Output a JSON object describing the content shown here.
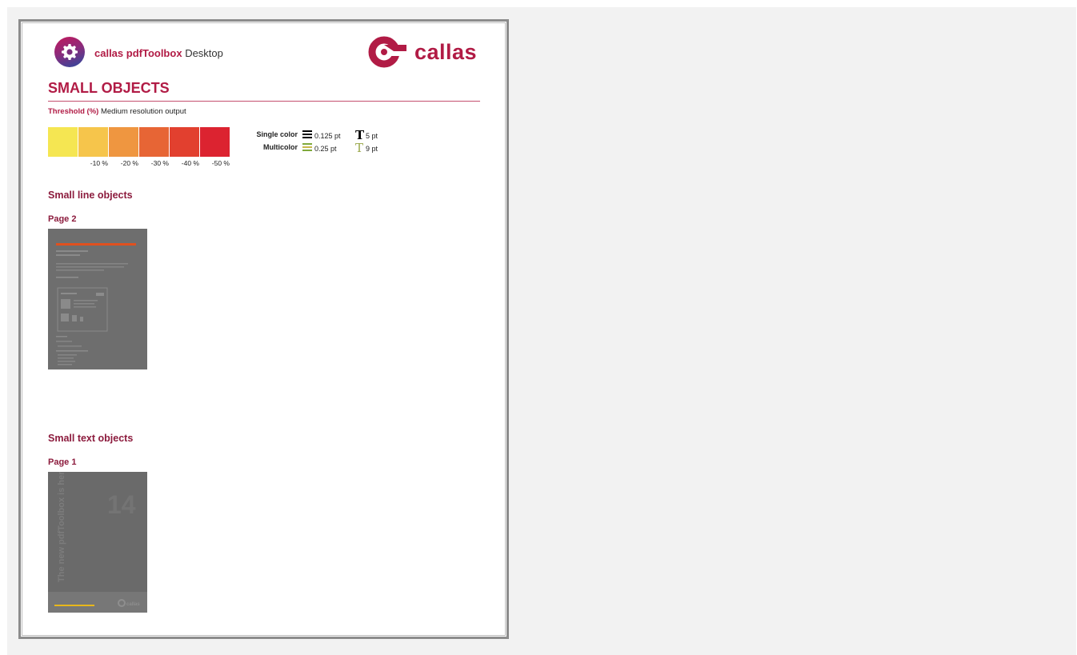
{
  "header": {
    "product_brand": "callas pdfToolbox",
    "product_edition": "Desktop",
    "company_logo_text": "callas"
  },
  "report": {
    "title": "SMALL OBJECTS",
    "threshold_label": "Threshold (%)",
    "threshold_value": "Medium resolution output"
  },
  "severity_scale": {
    "swatches": [
      {
        "color": "#f5e652",
        "label": ""
      },
      {
        "color": "#f6c54b",
        "label": "-10 %"
      },
      {
        "color": "#ef9640",
        "label": "-20 %"
      },
      {
        "color": "#e76535",
        "label": "-30 %"
      },
      {
        "color": "#e2402f",
        "label": "-40 %"
      },
      {
        "color": "#dc2330",
        "label": "-50 %"
      }
    ]
  },
  "legend": {
    "single_label": "Single color",
    "single_line": "0.125 pt",
    "single_text": "5 pt",
    "multi_label": "Multicolor",
    "multi_line": "0.25 pt",
    "multi_text": "9 pt",
    "text_icon": "T"
  },
  "sections": [
    {
      "title": "Small line objects",
      "page": "Page 2"
    },
    {
      "title": "Small text objects",
      "page": "Page 1"
    }
  ],
  "thumb_text": {
    "cover_title": "The new pdfToolbox is here",
    "cover_number": "14",
    "cover_logo": "callas"
  },
  "colors": {
    "brand": "#b11b45",
    "section": "#8c1b3d",
    "multicolor_green": "#7fa93c",
    "multicolor_text": "#9aa84a"
  }
}
